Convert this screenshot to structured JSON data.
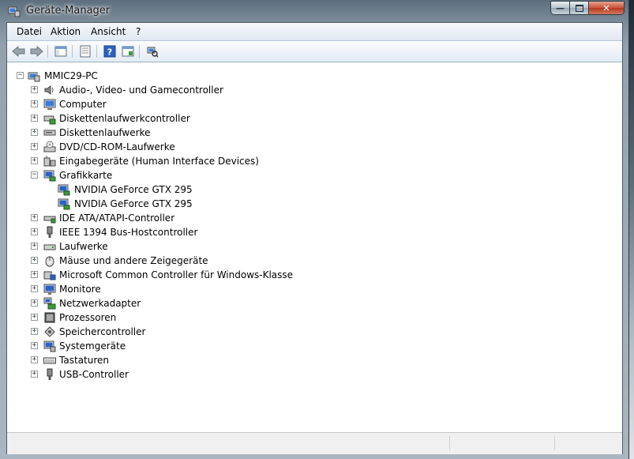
{
  "window": {
    "title": "Geräte-Manager"
  },
  "menu": [
    "Datei",
    "Aktion",
    "Ansicht",
    "?"
  ],
  "toolbar": [
    "back-icon",
    "forward-icon",
    "show-hide-console-tree-icon",
    "properties-icon",
    "help-icon",
    "update-driver-icon",
    "scan-hardware-changes-icon"
  ],
  "tree": {
    "root": "MMIC29-PC",
    "categories": [
      {
        "label": "Audio-, Video- und Gamecontroller",
        "icon": "speaker-icon",
        "expanded": false
      },
      {
        "label": "Computer",
        "icon": "computer-icon",
        "expanded": false
      },
      {
        "label": "Diskettenlaufwerkcontroller",
        "icon": "floppy-controller-icon",
        "expanded": false
      },
      {
        "label": "Diskettenlaufwerke",
        "icon": "floppy-drive-icon",
        "expanded": false
      },
      {
        "label": "DVD/CD-ROM-Laufwerke",
        "icon": "dvd-drive-icon",
        "expanded": false
      },
      {
        "label": "Eingabegeräte (Human Interface Devices)",
        "icon": "hid-icon",
        "expanded": false
      },
      {
        "label": "Grafikkarte",
        "icon": "display-adapter-icon",
        "expanded": true,
        "children": [
          "NVIDIA GeForce GTX 295",
          "NVIDIA GeForce GTX 295"
        ]
      },
      {
        "label": "IDE ATA/ATAPI-Controller",
        "icon": "ide-controller-icon",
        "expanded": false
      },
      {
        "label": "IEEE 1394 Bus-Hostcontroller",
        "icon": "firewire-icon",
        "expanded": false
      },
      {
        "label": "Laufwerke",
        "icon": "disk-drive-icon",
        "expanded": false
      },
      {
        "label": "Mäuse und andere Zeigegeräte",
        "icon": "mouse-icon",
        "expanded": false
      },
      {
        "label": "Microsoft Common Controller für Windows-Klasse",
        "icon": "controller-icon",
        "expanded": false
      },
      {
        "label": "Monitore",
        "icon": "monitor-icon",
        "expanded": false
      },
      {
        "label": "Netzwerkadapter",
        "icon": "network-adapter-icon",
        "expanded": false
      },
      {
        "label": "Prozessoren",
        "icon": "processor-icon",
        "expanded": false
      },
      {
        "label": "Speichercontroller",
        "icon": "storage-controller-icon",
        "expanded": false
      },
      {
        "label": "Systemgeräte",
        "icon": "system-devices-icon",
        "expanded": false
      },
      {
        "label": "Tastaturen",
        "icon": "keyboard-icon",
        "expanded": false
      },
      {
        "label": "USB-Controller",
        "icon": "usb-icon",
        "expanded": false
      }
    ]
  },
  "colors": {
    "selection": "#3399ff",
    "titlebar": "#7e8e9b"
  }
}
